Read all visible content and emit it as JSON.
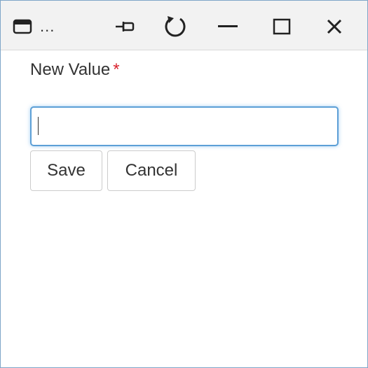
{
  "window": {
    "title": "...",
    "icons": {
      "app": "window-app-icon",
      "pin": "pin-icon",
      "refresh": "refresh-icon",
      "minimize": "minimize-icon",
      "maximize": "maximize-icon",
      "close": "close-icon"
    }
  },
  "form": {
    "label": "New Value",
    "required_marker": "*",
    "input_value": "",
    "input_placeholder": ""
  },
  "actions": {
    "save_label": "Save",
    "cancel_label": "Cancel"
  },
  "colors": {
    "input_focus_border": "#5c9fd6",
    "required": "#d9232e",
    "titlebar_bg": "#f2f2f2"
  }
}
